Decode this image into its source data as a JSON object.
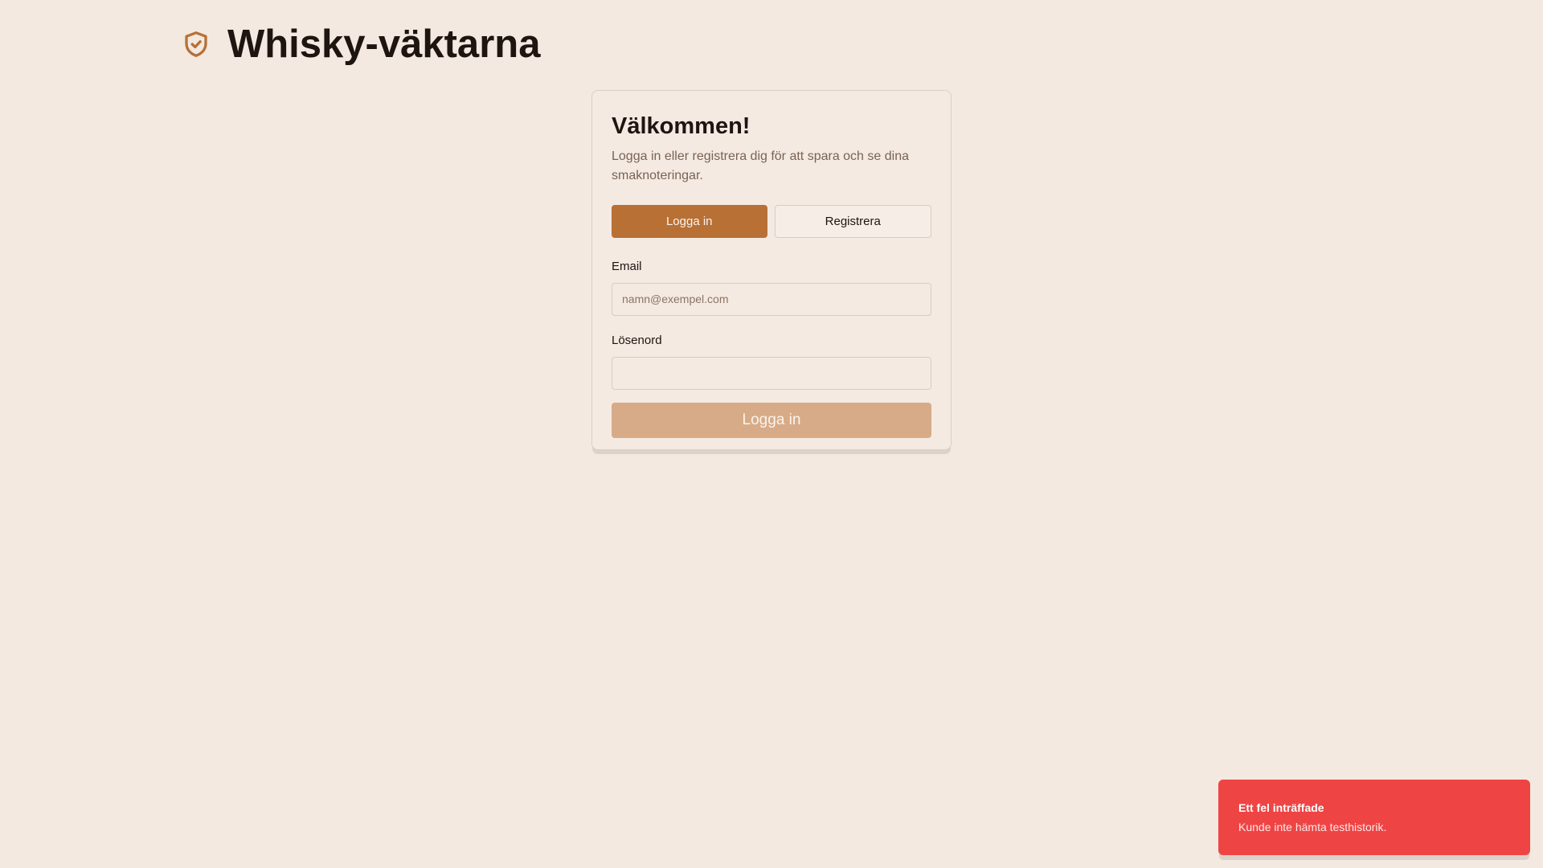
{
  "app": {
    "title": "Whisky-väktarna",
    "logo_icon": "shield-check-icon",
    "accent_color": "#b87035"
  },
  "auth_card": {
    "title": "Välkommen!",
    "subtitle": "Logga in eller registrera dig för att spara och se dina smaknoteringar.",
    "tabs": [
      {
        "label": "Logga in",
        "active": true
      },
      {
        "label": "Registrera",
        "active": false
      }
    ],
    "email": {
      "label": "Email",
      "placeholder": "namn@exempel.com",
      "value": ""
    },
    "password": {
      "label": "Lösenord",
      "value": ""
    },
    "submit_label": "Logga in",
    "submit_disabled": true
  },
  "toast": {
    "title": "Ett fel inträffade",
    "message": "Kunde inte hämta testhistorik.",
    "color": "#ef4444"
  }
}
